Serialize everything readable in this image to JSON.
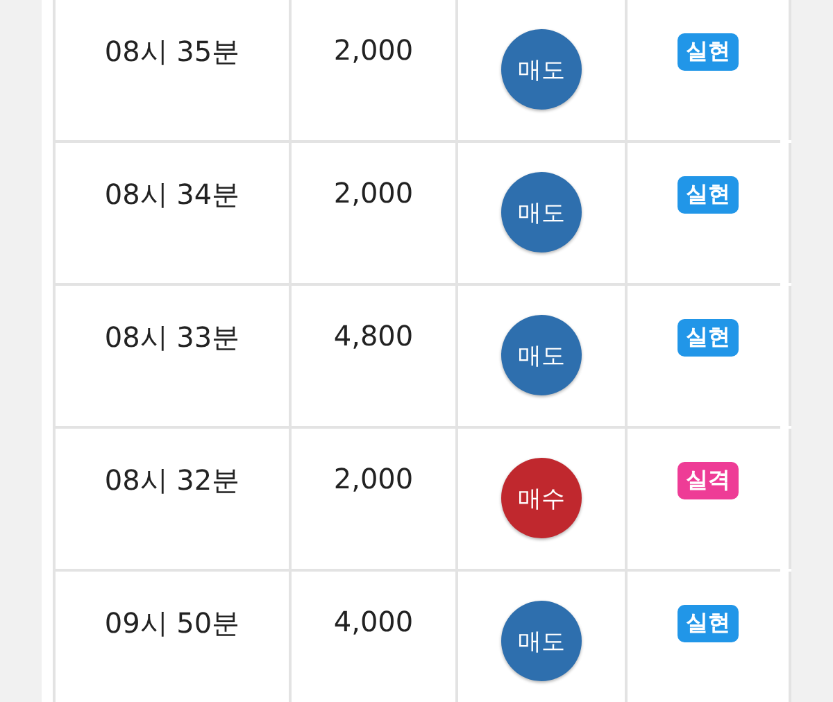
{
  "rows": [
    {
      "time": "08시 35분",
      "amount": "2,000",
      "side": {
        "label": "매도",
        "kind": "sell"
      },
      "result": {
        "label": "실현",
        "kind": "win"
      }
    },
    {
      "time": "08시 34분",
      "amount": "2,000",
      "side": {
        "label": "매도",
        "kind": "sell"
      },
      "result": {
        "label": "실현",
        "kind": "win"
      }
    },
    {
      "time": "08시 33분",
      "amount": "4,800",
      "side": {
        "label": "매도",
        "kind": "sell"
      },
      "result": {
        "label": "실현",
        "kind": "win"
      }
    },
    {
      "time": "08시 32분",
      "amount": "2,000",
      "side": {
        "label": "매수",
        "kind": "buy"
      },
      "result": {
        "label": "실격",
        "kind": "loss"
      }
    },
    {
      "time": "09시 50분",
      "amount": "4,000",
      "side": {
        "label": "매도",
        "kind": "sell"
      },
      "result": {
        "label": "실현",
        "kind": "win"
      }
    }
  ]
}
